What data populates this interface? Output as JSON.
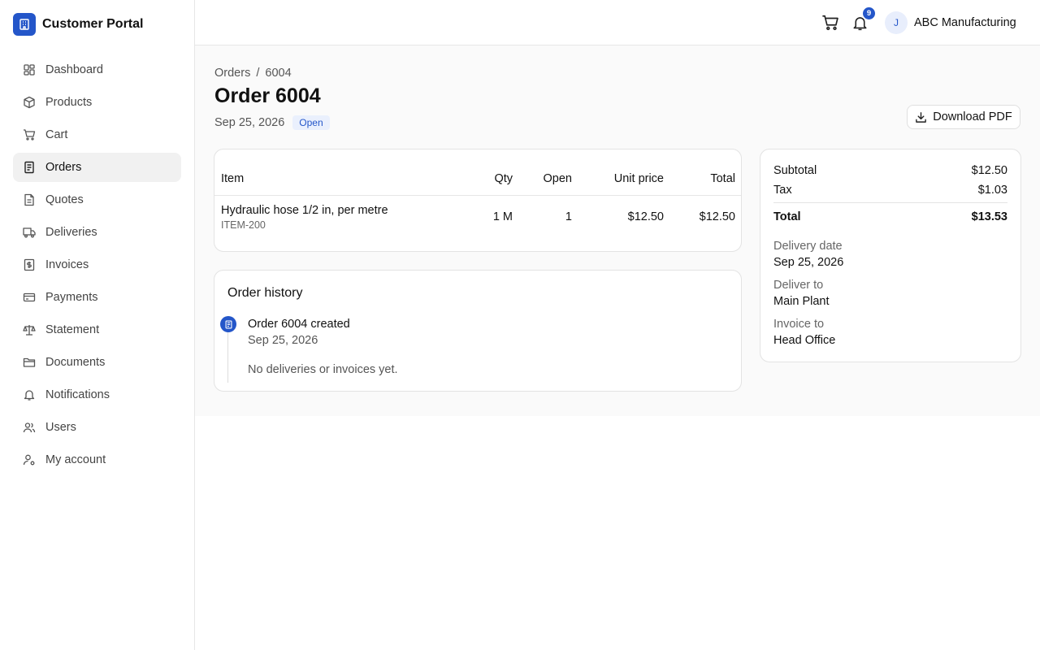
{
  "brand": {
    "name": "Customer Portal",
    "icon": "building-icon",
    "color": "#2456c9"
  },
  "sidebar": {
    "items": [
      {
        "label": "Dashboard",
        "icon": "grid-icon"
      },
      {
        "label": "Products",
        "icon": "box-icon"
      },
      {
        "label": "Cart",
        "icon": "cart-icon"
      },
      {
        "label": "Orders",
        "icon": "document-icon",
        "active": true
      },
      {
        "label": "Quotes",
        "icon": "file-icon"
      },
      {
        "label": "Deliveries",
        "icon": "truck-icon"
      },
      {
        "label": "Invoices",
        "icon": "dollar-file-icon"
      },
      {
        "label": "Payments",
        "icon": "credit-card-icon"
      },
      {
        "label": "Statement",
        "icon": "scale-icon"
      },
      {
        "label": "Documents",
        "icon": "folder-icon"
      },
      {
        "label": "Notifications",
        "icon": "bell-icon"
      },
      {
        "label": "Users",
        "icon": "users-icon"
      },
      {
        "label": "My account",
        "icon": "user-cog-icon"
      }
    ]
  },
  "header": {
    "notification_count": "9",
    "user_initial": "J",
    "user_name": "ABC Manufacturing"
  },
  "page": {
    "breadcrumb_root": "Orders",
    "breadcrumb_separator": "/",
    "breadcrumb_current": "6004",
    "title": "Order 6004",
    "date": "Sep 25, 2026",
    "status": "Open",
    "download_label": "Download PDF"
  },
  "items_table": {
    "headers": {
      "item": "Item",
      "qty": "Qty",
      "open": "Open",
      "unit_price": "Unit price",
      "total": "Total"
    },
    "rows": [
      {
        "name": "Hydraulic hose 1/2 in, per metre",
        "sku": "ITEM-200",
        "qty": "1 M",
        "open": "1",
        "unit_price": "$12.50",
        "total": "$12.50"
      }
    ]
  },
  "history": {
    "title": "Order history",
    "events": [
      {
        "title": "Order 6004 created",
        "date": "Sep 25, 2026"
      }
    ],
    "empty_text": "No deliveries or invoices yet."
  },
  "summary": {
    "subtotal_label": "Subtotal",
    "subtotal": "$12.50",
    "tax_label": "Tax",
    "tax": "$1.03",
    "total_label": "Total",
    "total": "$13.53",
    "delivery_date_label": "Delivery date",
    "delivery_date": "Sep 25, 2026",
    "deliver_to_label": "Deliver to",
    "deliver_to": "Main Plant",
    "invoice_to_label": "Invoice to",
    "invoice_to": "Head Office"
  }
}
